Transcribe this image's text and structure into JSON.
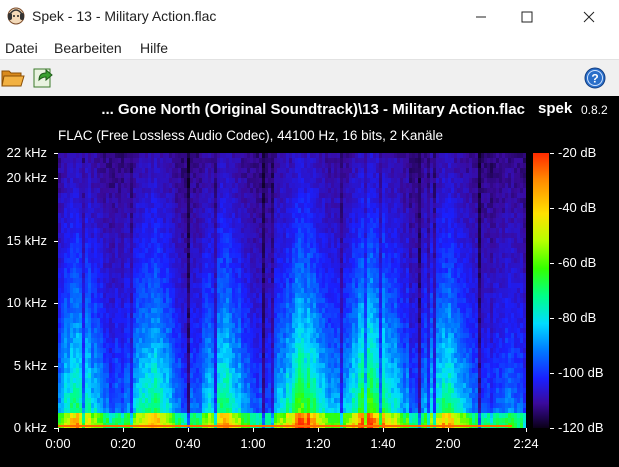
{
  "window": {
    "title": "Spek - 13 - Military Action.flac"
  },
  "menu": {
    "items": [
      "Datei",
      "Bearbeiten",
      "Hilfe"
    ]
  },
  "toolbar": {
    "open_icon": "folder-open-icon",
    "save_icon": "save-export-icon",
    "help_icon": "help-icon"
  },
  "viewer": {
    "file_title": "... Gone North (Original Soundtrack)\\13 - Military Action.flac",
    "app_name": "spek",
    "version": "0.8.2",
    "file_info": "FLAC (Free Lossless Audio Codec), 44100 Hz, 16 bits, 2 Kanäle",
    "freq_ticks": [
      "22 kHz",
      "20 kHz",
      "15 kHz",
      "10 kHz",
      "5 kHz",
      "0 kHz"
    ],
    "freq_values_khz": [
      22,
      20,
      15,
      10,
      5,
      0
    ],
    "time_ticks": [
      "0:00",
      "0:20",
      "0:40",
      "1:00",
      "1:20",
      "1:40",
      "2:00",
      "2:24"
    ],
    "time_values_s": [
      0,
      20,
      40,
      60,
      80,
      100,
      120,
      144
    ],
    "db_ticks": [
      "-20 dB",
      "-40 dB",
      "-60 dB",
      "-80 dB",
      "-100 dB",
      "-120 dB"
    ],
    "db_values": [
      -20,
      -40,
      -60,
      -80,
      -100,
      -120
    ]
  },
  "colors": {
    "background": "#000000",
    "text": "#ffffff",
    "toolbar_bg": "#f0f0f0"
  }
}
